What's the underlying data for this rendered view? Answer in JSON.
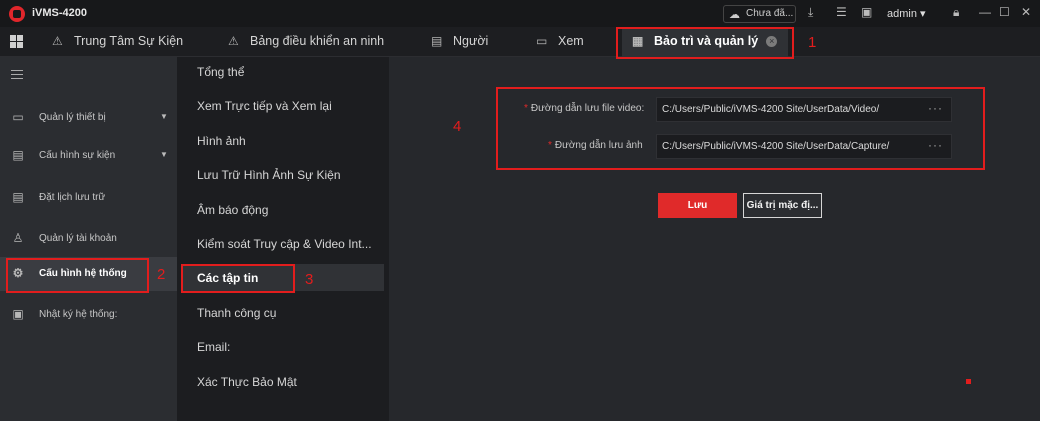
{
  "app": {
    "title": "iVMS-4200",
    "sync_label": "Chưa đã...",
    "user": "admin"
  },
  "tabs": [
    {
      "label": "Trung Tâm Sự Kiện",
      "icon": "alarm-icon"
    },
    {
      "label": "Bảng điều khiển an ninh",
      "icon": "alarm-icon"
    },
    {
      "label": "Người",
      "icon": "person-card-icon"
    },
    {
      "label": "Xem",
      "icon": "camera-icon"
    },
    {
      "label": "Bảo trì và quản lý",
      "icon": "maintenance-icon",
      "active": true
    }
  ],
  "sidebar": {
    "items": [
      {
        "label": "Quản lý thiết bị",
        "icon": "device-icon",
        "expandable": true
      },
      {
        "label": "Cấu hình sự kiện",
        "icon": "event-icon",
        "expandable": true
      },
      {
        "label": "Đặt lịch lưu trữ",
        "icon": "storage-icon"
      },
      {
        "label": "Quản lý tài khoản",
        "icon": "user-icon"
      },
      {
        "label": "Cấu hình hệ thống",
        "icon": "gear-icon",
        "active": true
      },
      {
        "label": "Nhật ký hệ thống:",
        "icon": "log-icon"
      }
    ]
  },
  "menu": {
    "items": [
      "Tổng thể",
      "Xem Trực tiếp và Xem lại",
      "Hình ảnh",
      "Lưu Trữ Hình Ảnh Sự Kiện",
      "Âm báo động",
      "Kiểm soát Truy cập & Video Int...",
      "Các tập tin",
      "Thanh công cụ",
      "Email:",
      "Xác Thực Bảo Mật"
    ],
    "active_index": 6
  },
  "form": {
    "video_label": "Đường dẫn lưu file video:",
    "video_path": "C:/Users/Public/iVMS-4200 Site/UserData/Video/",
    "image_label": "Đường dẫn lưu ảnh",
    "image_path": "C:/Users/Public/iVMS-4200 Site/UserData/Capture/",
    "browse": "···",
    "required_mark": "*",
    "save_label": "Lưu",
    "default_label": "Giá trị mặc đị..."
  },
  "annotations": [
    "1",
    "2",
    "3",
    "4"
  ],
  "colors": {
    "accent": "#e02a2a",
    "annotation": "#e21d1d",
    "background": "#26282c"
  }
}
